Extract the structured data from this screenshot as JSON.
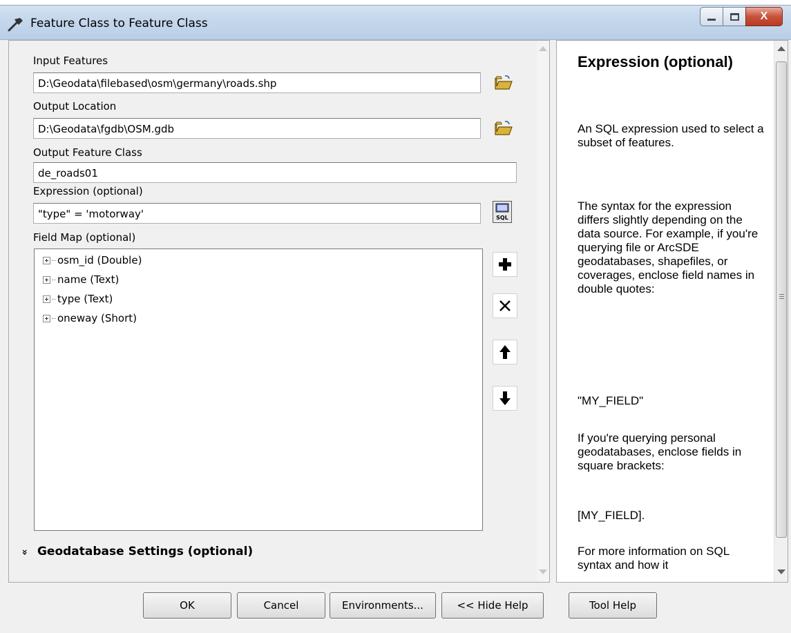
{
  "window": {
    "title": "Feature Class to Feature Class",
    "close_glyph": "X"
  },
  "form": {
    "input_features_label": "Input Features",
    "input_features_value": "D:\\Geodata\\filebased\\osm\\germany\\roads.shp",
    "output_location_label": "Output Location",
    "output_location_value": "D:\\Geodata\\fgdb\\OSM.gdb",
    "output_feature_class_label": "Output Feature Class",
    "output_feature_class_value": "de_roads01",
    "expression_label": "Expression (optional)",
    "expression_value": "\"type\" = 'motorway'",
    "field_map_label": "Field Map (optional)",
    "field_map_items": [
      "osm_id (Double)",
      "name (Text)",
      "type (Text)",
      "oneway (Short)"
    ],
    "geodatabase_settings_label": "Geodatabase Settings (optional)",
    "collapse_glyph": "»"
  },
  "help": {
    "heading": "Expression (optional)",
    "paragraphs": [
      "An SQL expression used to select a subset of features.",
      "The syntax for the expression differs slightly depending on the data source. For example, if you're querying file or ArcSDE geodatabases, shapefiles, or coverages, enclose field names in double quotes:",
      "\"MY_FIELD\"",
      "If you're querying personal geodatabases, enclose fields in square brackets:",
      "[MY_FIELD].",
      "For more information on SQL syntax and how it"
    ]
  },
  "buttons": {
    "ok": "OK",
    "cancel": "Cancel",
    "environments": "Environments...",
    "hide_help": "<< Hide Help",
    "tool_help": "Tool Help"
  },
  "icons": {
    "app": "hammer-icon",
    "browse": "open-folder-icon",
    "sql": "sql-icon",
    "add": "plus-icon",
    "delete": "delete-x-icon",
    "up": "arrow-up-icon",
    "down": "arrow-down-icon"
  }
}
